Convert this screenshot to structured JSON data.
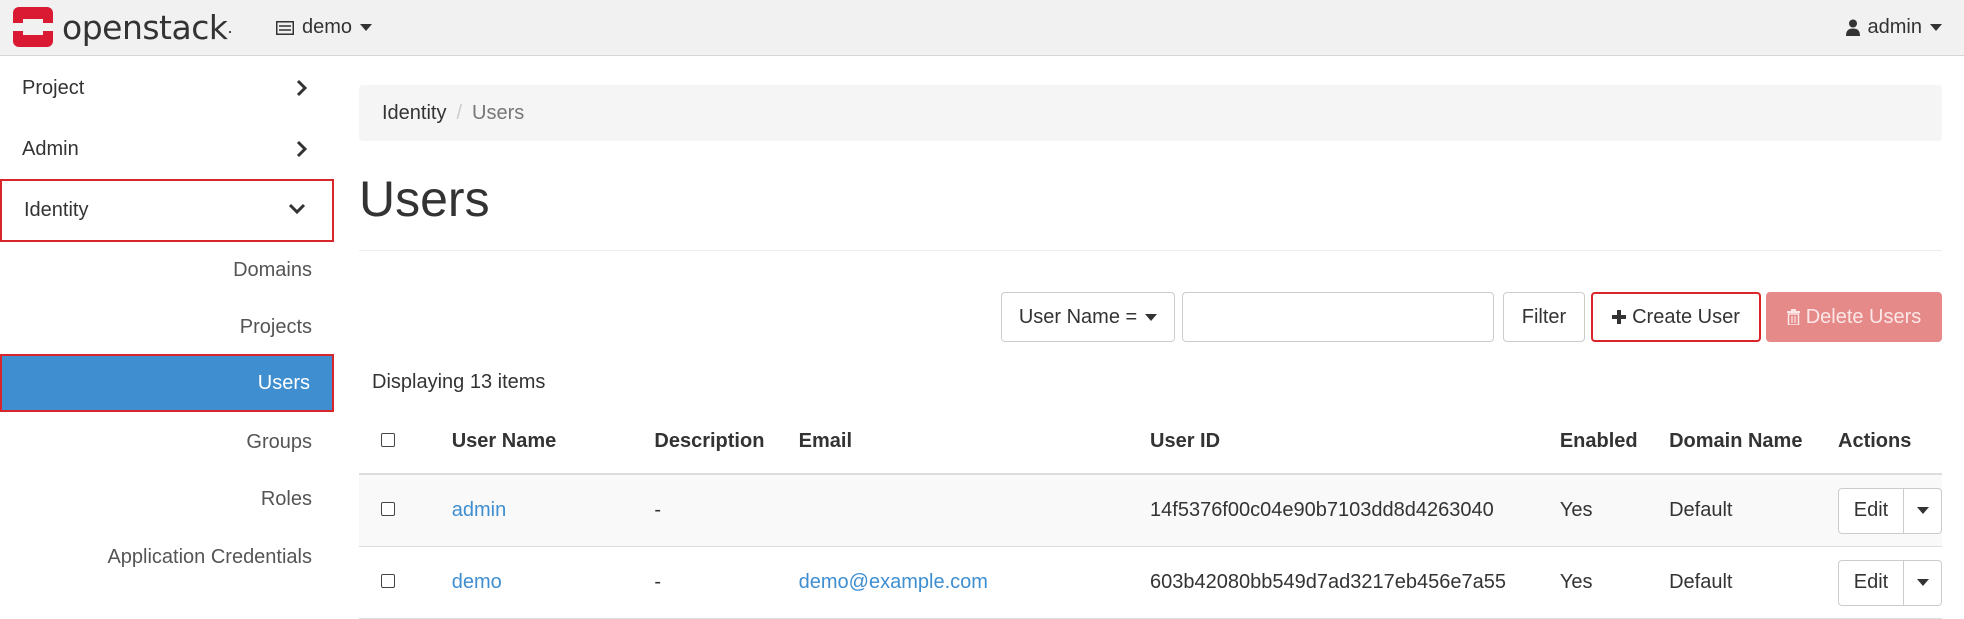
{
  "header": {
    "logo_text": "openstack",
    "project": "demo",
    "user": "admin",
    "brand_color": "#da1a32"
  },
  "sidebar": {
    "project_label": "Project",
    "admin_label": "Admin",
    "identity_label": "Identity",
    "items": [
      {
        "label": "Domains"
      },
      {
        "label": "Projects"
      },
      {
        "label": "Users",
        "active": true
      },
      {
        "label": "Groups"
      },
      {
        "label": "Roles"
      },
      {
        "label": "Application Credentials"
      }
    ],
    "active_color": "#3e8ed0"
  },
  "breadcrumb": {
    "parent": "Identity",
    "separator": "/",
    "current": "Users"
  },
  "page": {
    "title": "Users",
    "count_text": "Displaying 13 items"
  },
  "toolbar": {
    "filter_select": "User Name =",
    "filter_input_value": "",
    "filter_button": "Filter",
    "create_button": "Create User",
    "delete_button": "Delete Users",
    "delete_color": "#e58a89"
  },
  "table": {
    "columns": [
      "User Name",
      "Description",
      "Email",
      "User ID",
      "Enabled",
      "Domain Name",
      "Actions"
    ],
    "rows": [
      {
        "name": "admin",
        "description": "-",
        "email": "",
        "id": "14f5376f00c04e90b7103dd8d4263040",
        "enabled": "Yes",
        "domain": "Default",
        "action": "Edit"
      },
      {
        "name": "demo",
        "description": "-",
        "email": "demo@example.com",
        "id": "603b42080bb549d7ad3217eb456e7a55",
        "enabled": "Yes",
        "domain": "Default",
        "action": "Edit"
      }
    ]
  }
}
